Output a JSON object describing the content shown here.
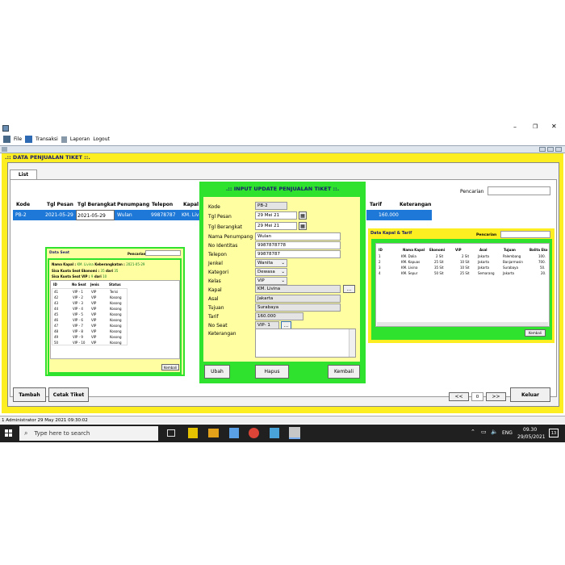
{
  "menu": [
    "File",
    "Transaksi",
    "Laporan",
    "Logout"
  ],
  "frame_title": ".:: DATA PENJUALAN TIKET ::.",
  "tab": "List",
  "pencarian_label": "Pencarian",
  "main_table": {
    "headers": [
      "Kode",
      "Tgl Pesan",
      "Tgl Berangkat",
      "Penumpang",
      "Telepon",
      "Kapal",
      "Tarif",
      "Keterangan"
    ],
    "row": [
      "PB-2",
      "2021-05-29",
      "2021-05-29",
      "Wulan",
      "99878787",
      "KM. Liv",
      "160.000",
      ""
    ]
  },
  "buttons": {
    "tambah": "Tambah",
    "cetak": "Cetak Tiket",
    "prev": "<<",
    "page": "0",
    "next": ">>",
    "keluar": "Keluar"
  },
  "seat_panel": {
    "title": "Data Seat",
    "pencarian": "Pencarian",
    "kapal_label": "Nama Kapal :",
    "kapal_value": "KM. Livina",
    "berangkat_label": "Keberangkatan :",
    "berangkat_value": "2021-05-29",
    "ekonomi_label": "Sisa Kuota Seat Ekonomi :",
    "ekonomi_value": "35",
    "ekonomi_dari": "dari",
    "ekonomi_total": "35",
    "vip_label": "Sisa Kuota Seat VIP :",
    "vip_value": "9",
    "vip_dari": "dari",
    "vip_total": "10",
    "headers": [
      "ID",
      "No Seat",
      "Jenis",
      "Status"
    ],
    "rows": [
      [
        "41",
        "VIP - 1",
        "VIP",
        "Terisi"
      ],
      [
        "42",
        "VIP - 2",
        "VIP",
        "Kosong"
      ],
      [
        "43",
        "VIP - 3",
        "VIP",
        "Kosong"
      ],
      [
        "44",
        "VIP - 4",
        "VIP",
        "Kosong"
      ],
      [
        "45",
        "VIP - 5",
        "VIP",
        "Kosong"
      ],
      [
        "46",
        "VIP - 6",
        "VIP",
        "Kosong"
      ],
      [
        "47",
        "VIP - 7",
        "VIP",
        "Kosong"
      ],
      [
        "48",
        "VIP - 8",
        "VIP",
        "Kosong"
      ],
      [
        "49",
        "VIP - 9",
        "VIP",
        "Kosong"
      ],
      [
        "50",
        "VIP - 10",
        "VIP",
        "Kosong"
      ]
    ],
    "kembali": "Kembali"
  },
  "kapal_panel": {
    "title": "Data Kapal & Tarif",
    "pencarian": "Pencarian",
    "headers": [
      "ID",
      "Nama Kapal",
      "Ekonomi",
      "VIP",
      "Asal",
      "Tujuan",
      "Balita Eko"
    ],
    "rows": [
      [
        "1",
        "KM. Dalia",
        "2 Sit",
        "2 Sit",
        "Jakarta",
        "Palembang",
        "100."
      ],
      [
        "2",
        "KM. Kapuas",
        "25 Sit",
        "10 Sit",
        "Jakarta",
        "Banjarmasin",
        "700."
      ],
      [
        "3",
        "KM. Livina",
        "35 Sit",
        "10 Sit",
        "Jakarta",
        "Surabaya",
        "50."
      ],
      [
        "4",
        "KM. Sepur",
        "50 Sit",
        "25 Sit",
        "Semarang",
        "Jakarta",
        "20."
      ]
    ],
    "kembali": "Kembali"
  },
  "update_form": {
    "title": ".:: INPUT UPDATE PENJUALAN TIKET ::.",
    "labels": [
      "Kode",
      "Tgl Pesan",
      "Tgl Berangkat",
      "Nama Penumpang",
      "No Identitas",
      "Telepon",
      "Jenkel",
      "Kategori",
      "Kelas",
      "Kapal",
      "Asal",
      "Tujuan",
      "Tarif",
      "No Seat",
      "Keterangan"
    ],
    "kode": "PB-2",
    "tgl_pesan": "29 Mei 21",
    "tgl_berangkat": "29 Mei 21",
    "nama": "Wulan",
    "identitas": "9987878778",
    "telepon": "99878787",
    "jenkel": "Wanita",
    "kategori": "Dewasa",
    "kelas": "VIP",
    "kapal": "KM. Livina",
    "asal": "Jakarta",
    "tujuan": "Surabaya",
    "tarif": "160.000",
    "no_seat": "VIP- 1",
    "dots": "...",
    "ubah": "Ubah",
    "hapus": "Hapus",
    "kembali": "Kembali"
  },
  "status_bar": "1 Administrator 29 May 2021 09:30:02",
  "taskbar": {
    "search": "Type here to search",
    "lang": "ENG",
    "time": "09.30",
    "date": "29/05/2021",
    "notif": "13"
  }
}
